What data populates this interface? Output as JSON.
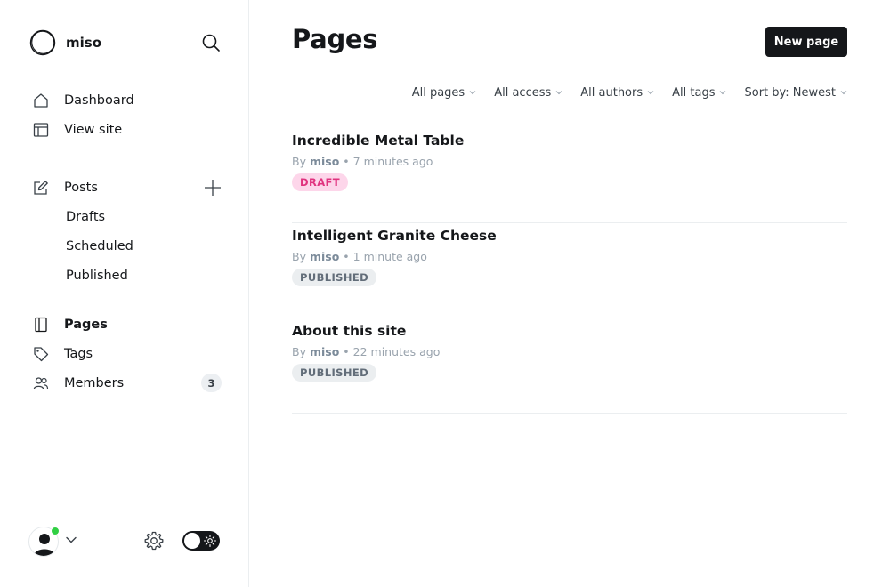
{
  "brand": {
    "name": "miso"
  },
  "nav": {
    "dashboard": "Dashboard",
    "view_site": "View site",
    "posts": "Posts",
    "drafts": "Drafts",
    "scheduled": "Scheduled",
    "published": "Published",
    "pages": "Pages",
    "tags": "Tags",
    "members": "Members",
    "members_count": "3"
  },
  "main": {
    "title": "Pages",
    "new_page_label": "New page",
    "filters": {
      "type": "All pages",
      "access": "All access",
      "authors": "All authors",
      "tags": "All tags",
      "sort": "Sort by: Newest"
    },
    "posts": [
      {
        "title": "Incredible Metal Table",
        "by": "By",
        "author": "miso",
        "time": "7 minutes ago",
        "status": "DRAFT"
      },
      {
        "title": "Intelligent Granite Cheese",
        "by": "By",
        "author": "miso",
        "time": "1 minute ago",
        "status": "PUBLISHED"
      },
      {
        "title": "About this site",
        "by": "By",
        "author": "miso",
        "time": "22 minutes ago",
        "status": "PUBLISHED"
      }
    ]
  },
  "colors": {
    "accent_dark": "#15171a",
    "draft_bg": "#fdd6ea",
    "draft_text": "#e0337f",
    "published_bg": "#ebeef0",
    "online": "#30cf43"
  },
  "icons": [
    "site-logo-icon",
    "search-icon",
    "home-icon",
    "layout-icon",
    "edit-icon",
    "plus-icon",
    "page-icon",
    "tag-icon",
    "members-icon",
    "user-avatar-icon",
    "chevron-down-icon",
    "gear-icon",
    "sun-icon"
  ]
}
